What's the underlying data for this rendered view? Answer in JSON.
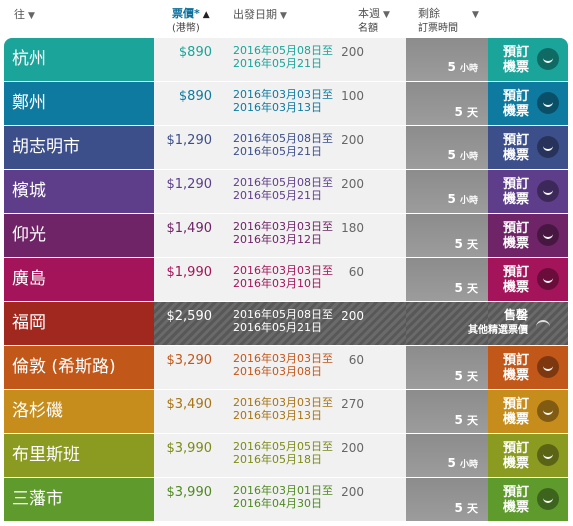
{
  "header": {
    "destination": "往",
    "price": "票價*",
    "price_unit": "(港幣)",
    "departure": "出發日期",
    "quota": "本週",
    "quota_sub": "名額",
    "remaining": "剩餘",
    "remaining_sub": "訂票時間",
    "sort_down_icon": "▼",
    "sort_up_icon": "▲"
  },
  "book_label_line1": "預訂",
  "book_label_line2": "機票",
  "sold_out_label": "售罄",
  "sold_out_sub": "其他精選票價",
  "rows": [
    {
      "city": "杭州",
      "price": "$890",
      "date_from": "2016年05月08日至",
      "date_to": "2016年05月21日",
      "quota": "200",
      "days": "5",
      "unit": "小時",
      "unit_small": true,
      "color": "#1aa49a",
      "text_color": "#1aa49a"
    },
    {
      "city": "鄭州",
      "price": "$890",
      "date_from": "2016年03月03日至",
      "date_to": "2016年03月13日",
      "quota": "100",
      "days": "5",
      "unit": "天",
      "unit_small": false,
      "color": "#0e7aa0",
      "text_color": "#0e7aa0"
    },
    {
      "city": "胡志明市",
      "price": "$1,290",
      "date_from": "2016年05月08日至",
      "date_to": "2016年05月21日",
      "quota": "200",
      "days": "5",
      "unit": "小時",
      "unit_small": true,
      "color": "#3d4f8a",
      "text_color": "#3d4f8a"
    },
    {
      "city": "檳城",
      "price": "$1,290",
      "date_from": "2016年05月08日至",
      "date_to": "2016年05月21日",
      "quota": "200",
      "days": "5",
      "unit": "小時",
      "unit_small": true,
      "color": "#5e3e8a",
      "text_color": "#5e3e8a"
    },
    {
      "city": "仰光",
      "price": "$1,490",
      "date_from": "2016年03月03日至",
      "date_to": "2016年03月12日",
      "quota": "180",
      "days": "5",
      "unit": "天",
      "unit_small": false,
      "color": "#6e2466",
      "text_color": "#6e2466"
    },
    {
      "city": "廣島",
      "price": "$1,990",
      "date_from": "2016年03月03日至",
      "date_to": "2016年03月10日",
      "quota": "60",
      "days": "5",
      "unit": "天",
      "unit_small": false,
      "color": "#a3145a",
      "text_color": "#a3145a"
    },
    {
      "city": "福岡",
      "price": "$2,590",
      "date_from": "2016年05月08日至",
      "date_to": "2016年05月21日",
      "quota": "200",
      "days": "",
      "unit": "",
      "unit_small": false,
      "color": "#a1281f",
      "text_color": "#ffffff",
      "sold_out": true
    },
    {
      "city": "倫敦 (希斯路)",
      "price": "$3,290",
      "date_from": "2016年03月03日至",
      "date_to": "2016年03月08日",
      "quota": "60",
      "days": "5",
      "unit": "天",
      "unit_small": false,
      "color": "#c2571a",
      "text_color": "#c2571a"
    },
    {
      "city": "洛杉磯",
      "price": "$3,490",
      "date_from": "2016年03月03日至",
      "date_to": "2016年03月13日",
      "quota": "270",
      "days": "5",
      "unit": "天",
      "unit_small": false,
      "color": "#c68c1c",
      "text_color": "#a77414"
    },
    {
      "city": "布里斯班",
      "price": "$3,990",
      "date_from": "2016年05月05日至",
      "date_to": "2016年05月18日",
      "quota": "200",
      "days": "5",
      "unit": "小時",
      "unit_small": true,
      "color": "#8b9a20",
      "text_color": "#7d8a18"
    },
    {
      "city": "三藩市",
      "price": "$3,990",
      "date_from": "2016年03月01日至",
      "date_to": "2016年04月30日",
      "quota": "200",
      "days": "5",
      "unit": "天",
      "unit_small": false,
      "color": "#5f9a2c",
      "text_color": "#4f8a20"
    }
  ]
}
